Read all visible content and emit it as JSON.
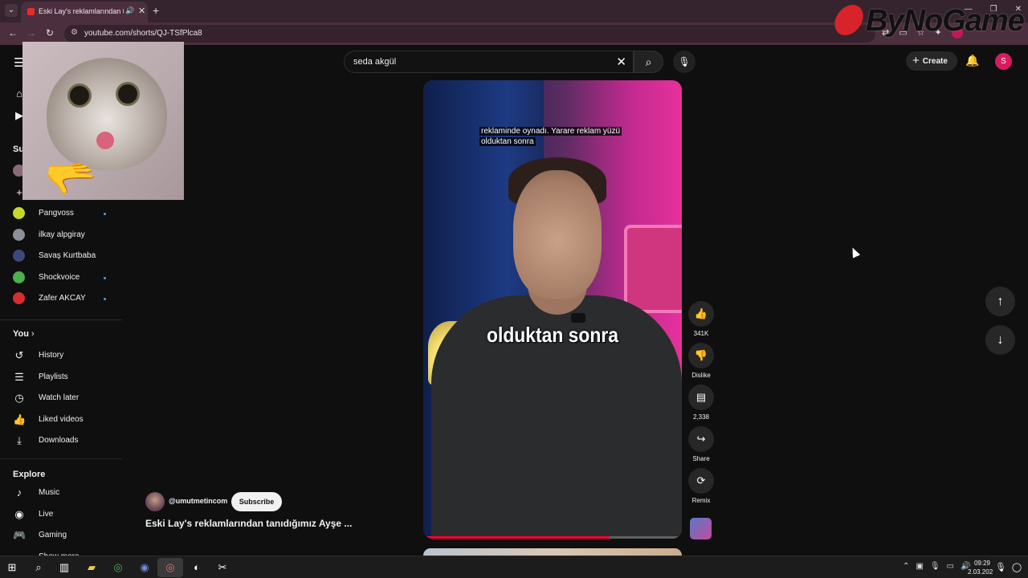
{
  "browser": {
    "tab_title": "Eski Lay's reklamlarından tanıdığımız Ayşe",
    "url": "youtube.com/shorts/QJ-TSfPlca8",
    "watermark": "ByNoGame"
  },
  "masthead": {
    "search_query": "seda akgül",
    "create_label": "Create",
    "avatar_letter": "S"
  },
  "sidebar": {
    "subscriptions_heading": "Su",
    "channels": [
      {
        "name": "Pangvoss",
        "new": true,
        "color": "#c7d82a"
      },
      {
        "name": "ilkay alpgiray",
        "new": false,
        "color": "#8a8f99"
      },
      {
        "name": "Savaş Kurtbaba",
        "new": false,
        "color": "#3c4a7a"
      },
      {
        "name": "Shockvoice",
        "new": true,
        "color": "#4caf50"
      },
      {
        "name": "Zafer AKCAY",
        "new": true,
        "color": "#d32f2f"
      }
    ],
    "you_heading": "You",
    "you_items": [
      {
        "label": "History",
        "icon": "history-icon"
      },
      {
        "label": "Playlists",
        "icon": "playlists-icon"
      },
      {
        "label": "Watch later",
        "icon": "clock-icon"
      },
      {
        "label": "Liked videos",
        "icon": "thumb-up-icon"
      },
      {
        "label": "Downloads",
        "icon": "download-icon"
      }
    ],
    "explore_heading": "Explore",
    "explore_items": [
      {
        "label": "Music",
        "icon": "music-icon"
      },
      {
        "label": "Live",
        "icon": "live-icon"
      },
      {
        "label": "Gaming",
        "icon": "gaming-icon"
      },
      {
        "label": "Show more",
        "icon": "show-more-icon"
      }
    ]
  },
  "short": {
    "caption_top_line1": "reklaminde oynadı. Yarare reklam yüzü",
    "caption_top_line2": "olduktan sonra",
    "caption_main": "olduktan sonra",
    "progress_fraction": 0.72,
    "likes": "341K",
    "dislike_label": "Dislike",
    "comments": "2,338",
    "share_label": "Share",
    "remix_label": "Remix",
    "channel_handle": "@umutmetincom",
    "subscribe_label": "Subscribe",
    "title": "Eski Lay's reklamlarından tanıdığımız Ayşe ..."
  },
  "taskbar": {
    "time": "09:29",
    "date": "2.03.202"
  },
  "colors": {
    "accent_red": "#ff0033",
    "background": "#0f0f0f",
    "button_bg": "#272727"
  }
}
